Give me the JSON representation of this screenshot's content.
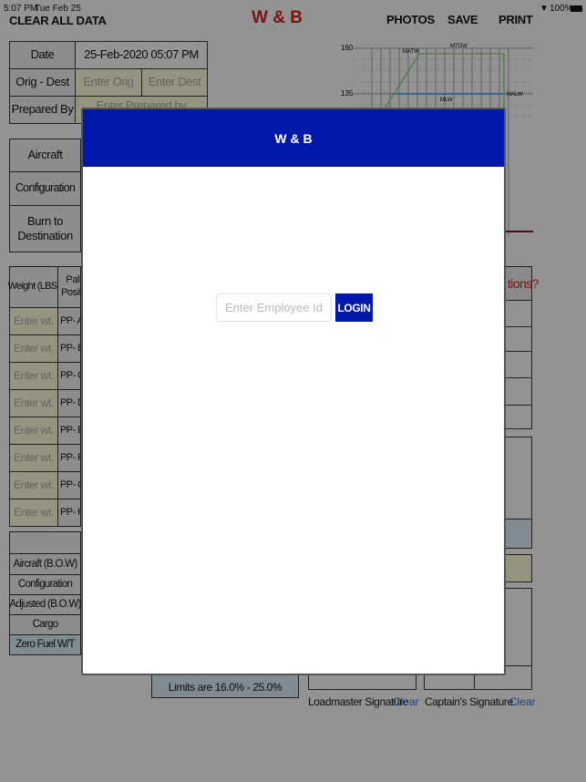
{
  "status_bar": {
    "time": "5:07 PM",
    "date": "Tue Feb 25",
    "battery": "100%"
  },
  "toolbar": {
    "clear_all": "CLEAR ALL DATA",
    "title": "W & B",
    "photos": "PHOTOS",
    "save": "SAVE",
    "print": "PRINT"
  },
  "info": {
    "date_label": "Date",
    "date_value": "25-Feb-2020 05:07 PM",
    "orig_dest_label": "Orig - Dest",
    "orig_placeholder": "Enter Orig",
    "dest_placeholder": "Enter Dest",
    "prepared_label": "Prepared By",
    "prepared_placeholder": "Enter Prepared by"
  },
  "aircraft": {
    "aircraft_label": "Aircraft",
    "configuration_label": "Configuration",
    "burn_label": "Burn to Destination"
  },
  "cargo": {
    "weight_header": "Weight (LBS)",
    "position_header": "Pallet Position",
    "weight_placeholder": "Enter wt.",
    "positions": [
      "PP- A",
      "PP- B",
      "PP- C",
      "PP- D",
      "PP- E",
      "PP- F",
      "PP- G",
      "PP- H"
    ]
  },
  "summary": {
    "rows": [
      "Aircraft (B.O.W)",
      "Configuration",
      "Adjusted (B.O.W)",
      "Cargo",
      "Zero Fuel W/T"
    ],
    "limits": "Limits are 16.0% - 25.0%"
  },
  "chart": {
    "ticks": [
      "160",
      "135"
    ],
    "labels": {
      "matw": "MATW",
      "mtow": "MTOW",
      "mlw": "MLW",
      "malw": "MALW"
    }
  },
  "question": "tions?",
  "signatures": {
    "loadmaster": "Loadmaster Signature",
    "captain": "Captain's Signature",
    "clear": "Clear"
  },
  "modal": {
    "title": "W & B",
    "employee_placeholder": "Enter Employee Id",
    "login": "LOGIN"
  },
  "colors": {
    "modal_header": "#0018a8",
    "title": "#c0201a",
    "link": "#1e5fc0"
  }
}
